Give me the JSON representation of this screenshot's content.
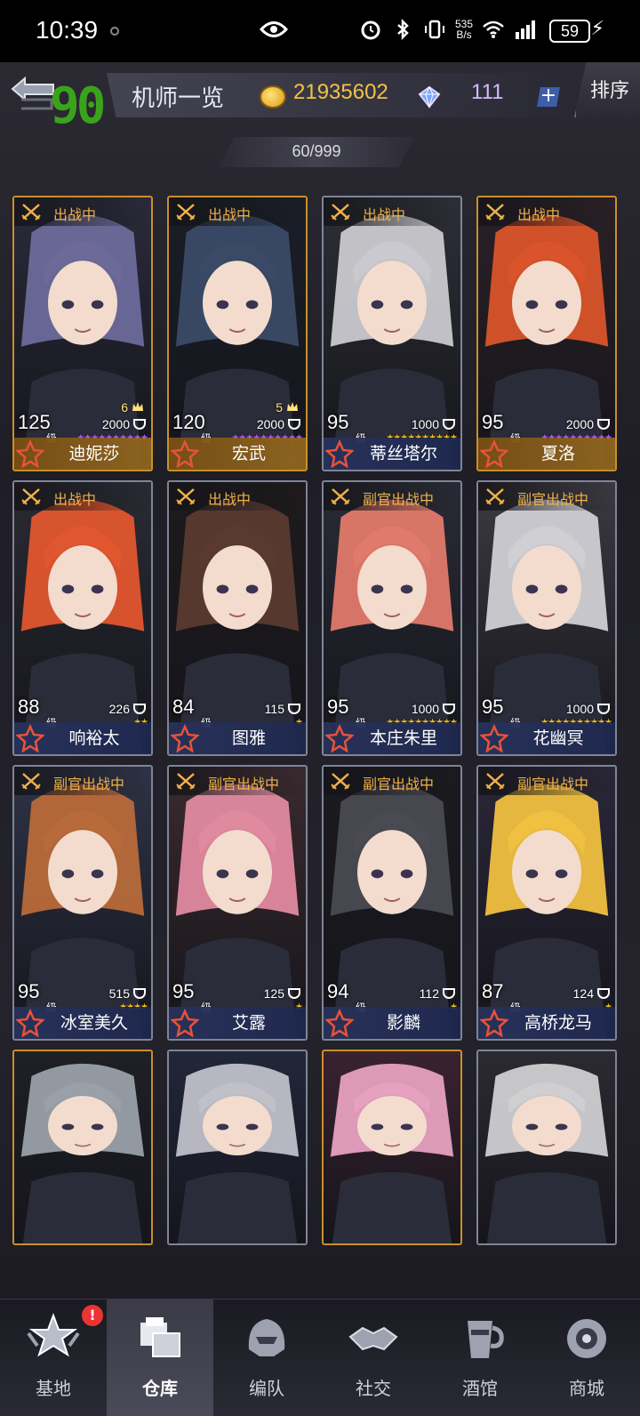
{
  "status_bar": {
    "time": "10:39",
    "net_speed_top": "535",
    "net_speed_bottom": "B/s",
    "battery": "59"
  },
  "header": {
    "fps_counter": "90",
    "title": "机师一览",
    "coins": "21935602",
    "gems": "111",
    "plus_label": "+",
    "sort_label": "排序"
  },
  "roster_count": "60/999",
  "colors": {
    "gold_frame": "#c98f2a",
    "silver_frame": "#7f8596",
    "status_orange": "#f0b14a",
    "coin_yellow": "#f3c244",
    "gem_purple": "#d7b8ff",
    "fps_green": "#3aa31c"
  },
  "pilots": [
    {
      "name": "迪妮莎",
      "status": "出战中",
      "level": "125",
      "level_unit": "级",
      "power": "2000",
      "crowns": "6",
      "stars": "★★★★★★★★★★",
      "star_color": "#b45cff",
      "frame": "gold",
      "bg": [
        "#6d6a9a",
        "#2a2a3a"
      ]
    },
    {
      "name": "宏武",
      "status": "出战中",
      "level": "120",
      "level_unit": "级",
      "power": "2000",
      "crowns": "5",
      "stars": "★★★★★★★★★★",
      "star_color": "#b45cff",
      "frame": "gold",
      "bg": [
        "#3a4a66",
        "#1a1e28"
      ]
    },
    {
      "name": "蒂丝塔尔",
      "status": "出战中",
      "level": "95",
      "level_unit": "级",
      "power": "1000",
      "crowns": "",
      "stars": "★★★★★★★★★★",
      "star_color": "#ffc21a",
      "frame": "silver",
      "bg": [
        "#c9c9cf",
        "#2e2f36"
      ]
    },
    {
      "name": "夏洛",
      "status": "出战中",
      "level": "95",
      "level_unit": "级",
      "power": "2000",
      "crowns": "",
      "stars": "★★★★★★★★★★",
      "star_color": "#b45cff",
      "frame": "gold",
      "bg": [
        "#d9542a",
        "#2a2026"
      ]
    },
    {
      "name": "响裕太",
      "status": "出战中",
      "level": "88",
      "level_unit": "级",
      "power": "226",
      "crowns": "",
      "stars": "★★",
      "star_color": "#ffc21a",
      "frame": "silver",
      "bg": [
        "#e0562e",
        "#2a2a33"
      ]
    },
    {
      "name": "图雅",
      "status": "出战中",
      "level": "84",
      "level_unit": "级",
      "power": "115",
      "crowns": "",
      "stars": "★",
      "star_color": "#ffc21a",
      "frame": "silver",
      "bg": [
        "#5a3a30",
        "#1e1a1c"
      ]
    },
    {
      "name": "本庄朱里",
      "status": "副官出战中",
      "level": "95",
      "level_unit": "级",
      "power": "1000",
      "crowns": "",
      "stars": "★★★★★★★★★★",
      "star_color": "#ffc21a",
      "frame": "silver",
      "bg": [
        "#e07a6a",
        "#2a2a36"
      ]
    },
    {
      "name": "花幽冥",
      "status": "副官出战中",
      "level": "95",
      "level_unit": "级",
      "power": "1000",
      "crowns": "",
      "stars": "★★★★★★★★★★",
      "star_color": "#ffc21a",
      "frame": "silver",
      "bg": [
        "#cfcfd4",
        "#3a3a40"
      ]
    },
    {
      "name": "冰室美久",
      "status": "副官出战中",
      "level": "95",
      "level_unit": "级",
      "power": "515",
      "crowns": "",
      "stars": "★★★★",
      "star_color": "#ffc21a",
      "frame": "silver",
      "bg": [
        "#b86a3a",
        "#2e3346"
      ]
    },
    {
      "name": "艾露",
      "status": "副官出战中",
      "level": "95",
      "level_unit": "级",
      "power": "125",
      "crowns": "",
      "stars": "★",
      "star_color": "#ffc21a",
      "frame": "silver",
      "bg": [
        "#e08aa0",
        "#3a2a2e"
      ]
    },
    {
      "name": "影麟",
      "status": "副官出战中",
      "level": "94",
      "level_unit": "级",
      "power": "112",
      "crowns": "",
      "stars": "★",
      "star_color": "#ffc21a",
      "frame": "silver",
      "bg": [
        "#4a4a52",
        "#1a1a20"
      ]
    },
    {
      "name": "高桥龙马",
      "status": "副官出战中",
      "level": "87",
      "level_unit": "级",
      "power": "124",
      "crowns": "",
      "stars": "★",
      "star_color": "#ffc21a",
      "frame": "silver",
      "bg": [
        "#f0c040",
        "#2a2638"
      ]
    },
    {
      "name": "",
      "status": "",
      "level": "",
      "level_unit": "",
      "power": "",
      "crowns": "",
      "stars": "",
      "star_color": "#ffc21a",
      "frame": "gold",
      "bg": [
        "#9aa0a8",
        "#1e2026"
      ]
    },
    {
      "name": "",
      "status": "",
      "level": "",
      "level_unit": "",
      "power": "",
      "crowns": "",
      "stars": "",
      "star_color": "#ffc21a",
      "frame": "silver",
      "bg": [
        "#bfc0c8",
        "#22263a"
      ]
    },
    {
      "name": "",
      "status": "",
      "level": "",
      "level_unit": "",
      "power": "",
      "crowns": "",
      "stars": "",
      "star_color": "#ffc21a",
      "frame": "gold",
      "bg": [
        "#e6a0c0",
        "#3a2230"
      ]
    },
    {
      "name": "",
      "status": "",
      "level": "",
      "level_unit": "",
      "power": "",
      "crowns": "",
      "stars": "",
      "star_color": "#ffc21a",
      "frame": "silver",
      "bg": [
        "#cfcfd2",
        "#2a2a30"
      ]
    }
  ],
  "nav": [
    {
      "label": "基地",
      "icon": "base-star-icon",
      "badge": "!"
    },
    {
      "label": "仓库",
      "icon": "warehouse-box-icon",
      "badge": ""
    },
    {
      "label": "编队",
      "icon": "formation-helmet-icon",
      "badge": ""
    },
    {
      "label": "社交",
      "icon": "handshake-icon",
      "badge": ""
    },
    {
      "label": "酒馆",
      "icon": "tavern-drink-icon",
      "badge": ""
    },
    {
      "label": "商城",
      "icon": "shop-orb-icon",
      "badge": ""
    }
  ],
  "nav_active_index": 1
}
